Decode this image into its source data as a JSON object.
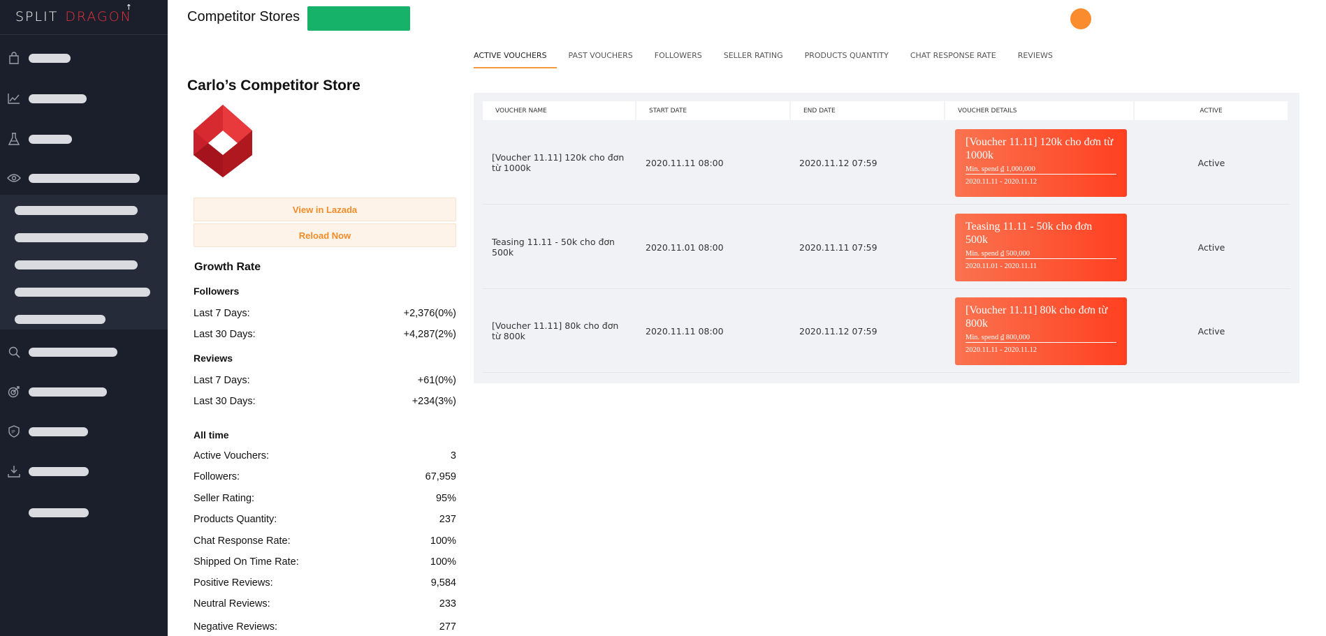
{
  "brand": {
    "word1": "SPLIT",
    "word2": "DRAGON",
    "accent": "#e8323c"
  },
  "header": {
    "title": "Competitor Stores",
    "button_color": "#17b26a",
    "avatar_color": "#fb8c2e"
  },
  "sidebar": {
    "background": "#1a1f2b",
    "items": [
      {
        "icon": "shopping-bag-icon"
      },
      {
        "icon": "trend-chart-icon"
      },
      {
        "icon": "flask-icon"
      },
      {
        "icon": "eye-icon"
      },
      {
        "icon": "search-icon"
      },
      {
        "icon": "target-icon"
      },
      {
        "icon": "ip-shield-icon"
      },
      {
        "icon": "download-icon"
      },
      {
        "icon": ""
      }
    ]
  },
  "store": {
    "name": "Carlo’s Competitor Store",
    "view_button": "View in Lazada",
    "reload_button": "Reload Now"
  },
  "growth": {
    "title": "Growth Rate",
    "followers": {
      "title": "Followers",
      "rows": [
        {
          "label": "Last 7 Days:",
          "value": "+2,376(0%)"
        },
        {
          "label": "Last 30 Days:",
          "value": "+4,287(2%)"
        }
      ]
    },
    "reviews": {
      "title": "Reviews",
      "rows": [
        {
          "label": "Last 7 Days:",
          "value": "+61(0%)"
        },
        {
          "label": "Last 30 Days:",
          "value": "+234(3%)"
        }
      ]
    }
  },
  "all_time": {
    "title": "All time",
    "rows": [
      {
        "label": "Active Vouchers:",
        "value": "3"
      },
      {
        "label": "Followers:",
        "value": "67,959"
      },
      {
        "label": "Seller Rating:",
        "value": "95%"
      },
      {
        "label": "Products Quantity:",
        "value": "237"
      },
      {
        "label": "Chat Response Rate:",
        "value": "100%"
      },
      {
        "label": "Shipped On Time Rate:",
        "value": "100%"
      },
      {
        "label": "Positive Reviews:",
        "value": "9,584"
      },
      {
        "label": "Neutral Reviews:",
        "value": "233"
      },
      {
        "label": "Negative Reviews:",
        "value": "277"
      }
    ]
  },
  "tabs": [
    "ACTIVE VOUCHERS",
    "PAST VOUCHERS",
    "FOLLOWERS",
    "SELLER RATING",
    "PRODUCTS QUANTITY",
    "CHAT RESPONSE RATE",
    "REVIEWS"
  ],
  "table": {
    "columns": [
      "VOUCHER NAME",
      "START DATE",
      "END DATE",
      "VOUCHER DETAILS",
      "ACTIVE"
    ],
    "rows": [
      {
        "name": "[Voucher 11.11] 120k cho đơn từ 1000k",
        "start": "2020.11.11 08:00",
        "end": "2020.11.12 07:59",
        "card_title": "[Voucher 11.11] 120k cho đơn từ 1000k",
        "card_min": "Min. spend ₫ 1,000,000",
        "card_dates": "2020.11.11 - 2020.11.12",
        "status": "Active"
      },
      {
        "name": "Teasing 11.11 - 50k cho đơn 500k",
        "start": "2020.11.01 08:00",
        "end": "2020.11.11 07:59",
        "card_title": "Teasing 11.11 - 50k cho đơn 500k",
        "card_min": "Min. spend ₫ 500,000",
        "card_dates": "2020.11.01 - 2020.11.11",
        "status": "Active"
      },
      {
        "name": "[Voucher 11.11] 80k cho đơn từ 800k",
        "start": "2020.11.11 08:00",
        "end": "2020.11.12 07:59",
        "card_title": "[Voucher 11.11] 80k cho đơn từ 800k",
        "card_min": "Min. spend ₫ 800,000",
        "card_dates": "2020.11.11 - 2020.11.12",
        "status": "Active"
      }
    ]
  }
}
